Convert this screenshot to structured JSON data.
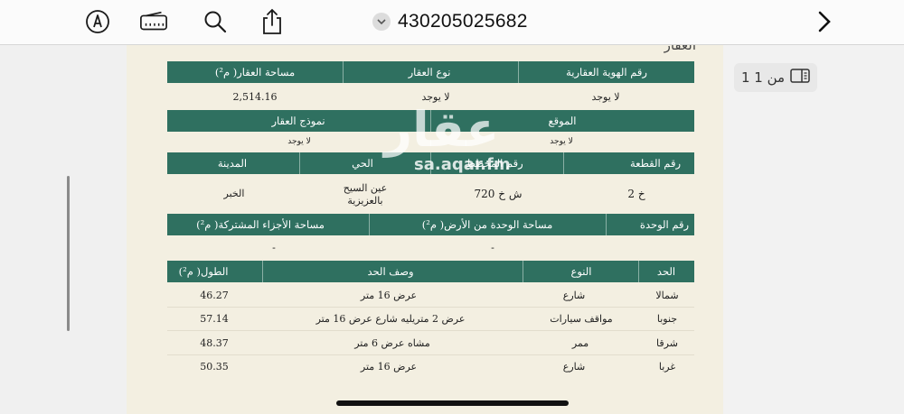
{
  "toolbar": {
    "doc_title": "430205025682",
    "icons": [
      "markup-pen-icon",
      "scan-ruler-icon",
      "search-icon",
      "share-icon",
      "chevron-down-icon",
      "chevron-right-icon"
    ]
  },
  "page_indicator": {
    "label": "1 من 1",
    "icon": "sidebar-pages-icon"
  },
  "document": {
    "partial_heading": "العقار",
    "property_section": {
      "headers": [
        "رقم الهوية العقارية",
        "نوع العقار",
        "مساحة العقار( م²)"
      ],
      "values": [
        "لا يوجد",
        "لا يوجد",
        "2,514.16"
      ]
    },
    "location_section": {
      "headers": [
        "الموقع",
        "نموذج العقار"
      ],
      "values": [
        "لا يوجد",
        "لا يوجد"
      ]
    },
    "plot_section": {
      "headers": [
        "رقم القطعة",
        "رقم المخطط",
        "الحي",
        "المدينة"
      ],
      "values": [
        "خ 2",
        "ش خ 720",
        "عين السيح",
        "بالعزيزية",
        "الخبر"
      ]
    },
    "unit_section": {
      "headers": [
        "رقم الوحدة",
        "مساحة الوحدة من الأرض( م²)",
        "مساحة الأجزاء المشتركة( م²)"
      ],
      "values": [
        "-",
        "-"
      ]
    },
    "boundaries": {
      "headers": [
        "الحد",
        "النوع",
        "وصف الحد",
        "الطول( م²)"
      ],
      "rows": [
        {
          "direction": "شمالا",
          "type": "شارع",
          "description": "عرض 16 متر",
          "length": "46.27"
        },
        {
          "direction": "جنوبا",
          "type": "مواقف سيارات",
          "description": "عرض 2 متريليه شارع عرض 16 متر",
          "length": "57.14"
        },
        {
          "direction": "شرقا",
          "type": "ممر",
          "description": "مشاه عرض 6 متر",
          "length": "48.37"
        },
        {
          "direction": "غربا",
          "type": "شارع",
          "description": "عرض 16 متر",
          "length": "50.35"
        }
      ]
    },
    "watermark": {
      "arabic": "عقار",
      "url": "sa.aqar.fm"
    }
  },
  "colors": {
    "band": "#2f7060",
    "paper": "#f3efe1",
    "toolbar": "#fbfbfb"
  }
}
